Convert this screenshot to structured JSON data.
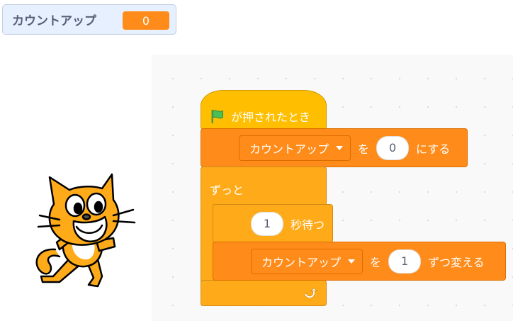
{
  "monitor": {
    "label": "カウントアップ",
    "value": "0"
  },
  "blocks": {
    "hat": {
      "label": "が押されたとき"
    },
    "set_var": {
      "variable": "カウントアップ",
      "word1": "を",
      "value": "0",
      "word2": "にする"
    },
    "forever": {
      "label": "ずっと"
    },
    "wait": {
      "value": "1",
      "label": "秒待つ"
    },
    "change_var": {
      "variable": "カウントアップ",
      "word1": "を",
      "value": "1",
      "word2": "ずつ変える"
    }
  },
  "icons": {
    "flag": "green-flag-icon",
    "loop": "loop-arrow-icon",
    "dropdown": "caret-down-icon"
  },
  "colors": {
    "events": "#ffbf00",
    "variables": "#ff8c1a",
    "control": "#ffab19",
    "monitor_bg": "#e6f0ff"
  }
}
